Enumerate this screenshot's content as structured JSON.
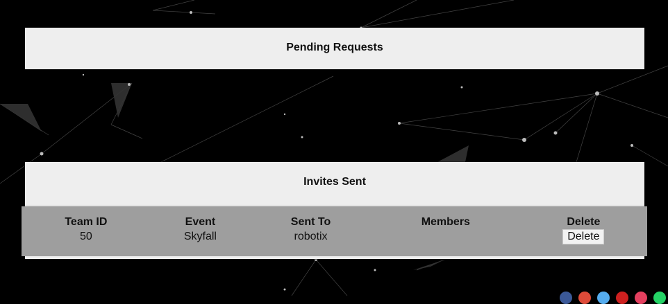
{
  "pending": {
    "title": "Pending Requests"
  },
  "invites": {
    "title": "Invites Sent",
    "columns": [
      "Team ID",
      "Event",
      "Sent To",
      "Members",
      "Delete"
    ],
    "rows": [
      {
        "team_id": "50",
        "event": "Skyfall",
        "sent_to": "robotix",
        "members": "",
        "delete_label": "Delete"
      }
    ]
  },
  "colors": {
    "background": "#000000",
    "panel": "#eeeeee",
    "table_bg": "#9e9e9e"
  },
  "icons": [
    "facebook-icon",
    "google-plus-icon",
    "twitter-icon",
    "youtube-icon",
    "instagram-icon",
    "whatsapp-icon"
  ]
}
